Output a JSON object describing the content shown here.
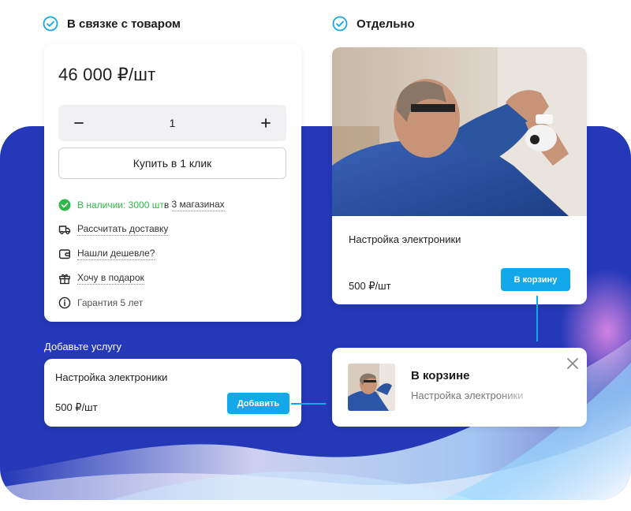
{
  "headings": {
    "bundle": "В связке с товаром",
    "separate": "Отдельно"
  },
  "product": {
    "price": "46 000 ₽/шт",
    "quantity": "1",
    "buy_one_click": "Купить в 1 клик",
    "availability": {
      "status": "В наличии: 3000 шт",
      "stores_prefix": "в ",
      "stores_link": "3 магазинах"
    },
    "links": {
      "delivery": "Рассчитать доставку",
      "cheaper": "Нашли дешевле?",
      "gift": "Хочу в подарок"
    },
    "warranty": "Гарантия 5 лет"
  },
  "services_section": {
    "label": "Добавьте услугу",
    "item": {
      "title": "Настройка электроники",
      "price": "500 ₽/шт",
      "add_label": "Добавить"
    }
  },
  "separate_card": {
    "title": "Настройка электроники",
    "price": "500 ₽/шт",
    "cart_label": "В корзину"
  },
  "toast": {
    "title": "В корзине",
    "subtitle": "Настройка электроники"
  },
  "colors": {
    "accent": "#12a8ea",
    "background_blue": "#2438b8",
    "in_stock_green": "#2fb84a"
  },
  "icons": [
    "check-circle-icon",
    "minus-icon",
    "plus-icon",
    "truck-icon",
    "wallet-icon",
    "gift-icon",
    "info-icon",
    "close-icon"
  ]
}
